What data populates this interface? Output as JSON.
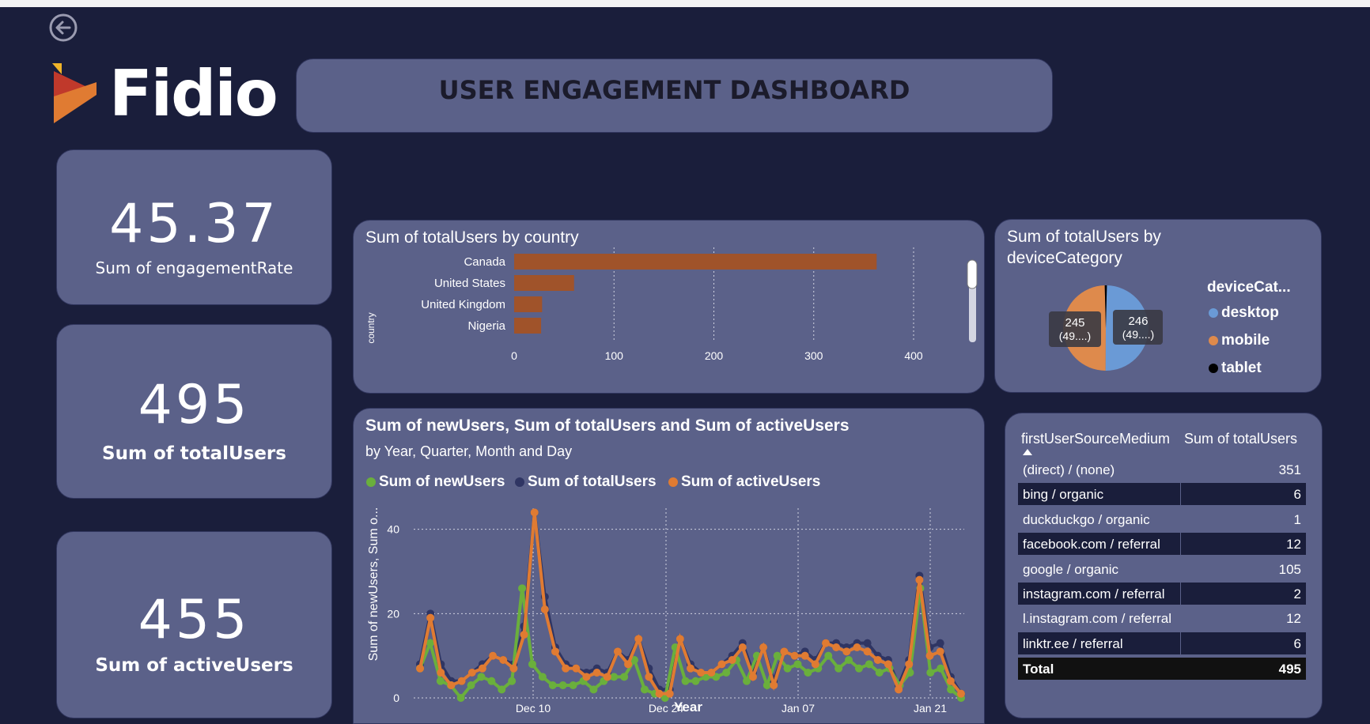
{
  "header": {
    "title": "USER ENGAGEMENT DASHBOARD",
    "logo_text": "Fidio"
  },
  "kpis": [
    {
      "value": "45.37",
      "label": "Sum of engagementRate"
    },
    {
      "value": "495",
      "label": "Sum of totalUsers"
    },
    {
      "value": "455",
      "label": "Sum of activeUsers"
    }
  ],
  "country_panel": {
    "title": "Sum of totalUsers by country"
  },
  "device_panel": {
    "title_line1": "Sum of totalUsers by",
    "title_line2": "deviceCategory",
    "legend_title": "deviceCat...",
    "labels": [
      {
        "line1": "245",
        "line2": "(49....)"
      },
      {
        "line1": "246",
        "line2": "(49....)"
      }
    ]
  },
  "trend_panel": {
    "title": "Sum of newUsers, Sum of totalUsers and Sum of activeUsers",
    "subtitle": "by Year, Quarter, Month and Day"
  },
  "source_table": {
    "col1": "firstUserSourceMedium",
    "col2": "Sum of totalUsers",
    "rows": [
      {
        "source": "(direct) / (none)",
        "value": "351"
      },
      {
        "source": "bing / organic",
        "value": "6"
      },
      {
        "source": "duckduckgo / organic",
        "value": "1"
      },
      {
        "source": "facebook.com / referral",
        "value": "12"
      },
      {
        "source": "google / organic",
        "value": "105"
      },
      {
        "source": "instagram.com / referral",
        "value": "2"
      },
      {
        "source": "l.instagram.com / referral",
        "value": "12"
      },
      {
        "source": "linktr.ee / referral",
        "value": "6"
      }
    ],
    "total_label": "Total",
    "total_value": "495"
  },
  "colors": {
    "background": "#1a1e3b",
    "card": "#5b6189",
    "bar": "#a0532a",
    "desktop": "#6a9ad6",
    "mobile": "#de8a4c",
    "tablet": "#000000",
    "new": "#6aaf3c",
    "total": "#2f3563",
    "active": "#e07b32"
  },
  "chart_data": [
    {
      "type": "bar",
      "title": "Sum of totalUsers by country",
      "ylabel": "country",
      "categories": [
        "Canada",
        "United States",
        "United Kingdom",
        "Nigeria"
      ],
      "values": [
        363,
        60,
        28,
        27
      ],
      "xlim": [
        0,
        400
      ],
      "xticks": [
        "0",
        "100",
        "200",
        "300",
        "400"
      ],
      "grid": true
    },
    {
      "type": "pie",
      "title": "Sum of totalUsers by deviceCategory",
      "legend_title": "deviceCat...",
      "series": [
        {
          "name": "desktop",
          "value": 246
        },
        {
          "name": "mobile",
          "value": 245
        },
        {
          "name": "tablet",
          "value": 4
        }
      ],
      "legend": "right"
    },
    {
      "type": "line",
      "title": "Sum of newUsers, Sum of totalUsers and Sum of activeUsers",
      "subtitle": "by Year, Quarter, Month and Day",
      "xlabel": "Year",
      "ylabel": "Sum of newUsers, Sum o...",
      "x_ticks": [
        "Dec 10",
        "Dec 24",
        "Jan 07",
        "Jan 21"
      ],
      "y_ticks": [
        "0",
        "20",
        "40"
      ],
      "ylim": [
        0,
        48
      ],
      "legend": "top-left",
      "series": [
        {
          "name": "Sum of newUsers",
          "values": [
            7,
            13,
            4,
            3,
            0,
            3,
            5,
            4,
            2,
            4,
            26,
            8,
            5,
            3,
            3,
            3,
            4,
            2,
            4,
            5,
            5,
            9,
            2,
            1,
            0,
            12,
            4,
            4,
            5,
            5,
            6,
            9,
            4,
            10,
            3,
            10,
            7,
            8,
            6,
            7,
            10,
            7,
            9,
            7,
            8,
            6,
            7,
            3,
            6,
            26,
            6,
            7,
            2,
            0
          ]
        },
        {
          "name": "Sum of totalUsers",
          "values": [
            8,
            20,
            8,
            4,
            4,
            6,
            8,
            10,
            9,
            8,
            17,
            44,
            24,
            12,
            8,
            7,
            6,
            7,
            6,
            11,
            9,
            14,
            7,
            2,
            2,
            14,
            8,
            6,
            6,
            8,
            10,
            13,
            6,
            12,
            4,
            11,
            10,
            11,
            9,
            13,
            13,
            12,
            13,
            13,
            10,
            9,
            3,
            9,
            29,
            12,
            13,
            5,
            1
          ]
        },
        {
          "name": "Sum of activeUsers",
          "values": [
            7,
            19,
            6,
            3,
            4,
            6,
            7,
            10,
            9,
            7,
            15,
            44,
            21,
            11,
            7,
            7,
            5,
            6,
            5,
            11,
            8,
            14,
            5,
            1,
            1,
            14,
            7,
            6,
            6,
            8,
            9,
            12,
            5,
            12,
            3,
            11,
            10,
            10,
            8,
            13,
            12,
            11,
            12,
            11,
            9,
            8,
            2,
            8,
            28,
            10,
            11,
            4,
            1
          ]
        }
      ]
    }
  ]
}
